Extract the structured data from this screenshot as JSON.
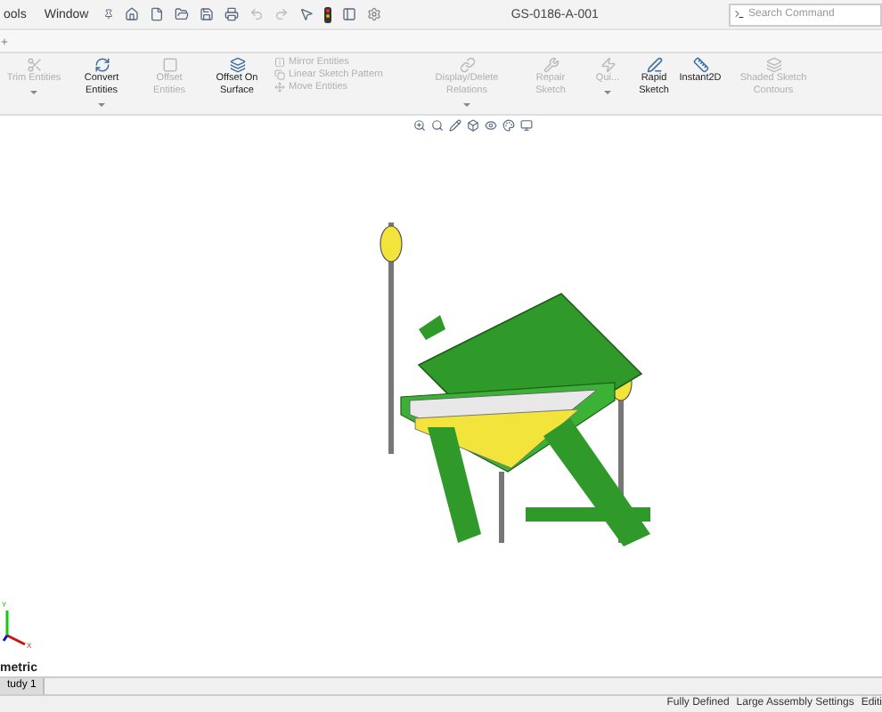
{
  "menu": [
    {
      "label": "ools"
    },
    {
      "label": "Window"
    }
  ],
  "title": "GS-0186-A-001",
  "search": {
    "placeholder": "Search Command"
  },
  "ribbon": [
    {
      "kind": "large",
      "label": "Trim Entities",
      "disabled": true,
      "dropdown": true
    },
    {
      "kind": "large",
      "label": "Convert Entities",
      "disabled": false,
      "dropdown": true
    },
    {
      "kind": "large",
      "label": "Offset Entities",
      "disabled": true,
      "dropdown": false
    },
    {
      "kind": "large",
      "label": "Offset On Surface",
      "disabled": false,
      "dropdown": false
    },
    {
      "kind": "stack",
      "items": [
        {
          "label": "Mirror Entities",
          "disabled": true
        },
        {
          "label": "Linear Sketch Pattern",
          "disabled": true
        },
        {
          "label": "Move Entities",
          "disabled": true
        }
      ]
    },
    {
      "kind": "large",
      "label": "Display/Delete Relations",
      "disabled": true,
      "dropdown": true
    },
    {
      "kind": "large",
      "label": "Repair Sketch",
      "disabled": true,
      "dropdown": false
    },
    {
      "kind": "large",
      "label": "Qui...",
      "disabled": true,
      "dropdown": true
    },
    {
      "kind": "large",
      "label": "Rapid Sketch",
      "disabled": false,
      "dropdown": false
    },
    {
      "kind": "large",
      "label": "Instant2D",
      "disabled": false,
      "dropdown": false
    },
    {
      "kind": "large",
      "label": "Shaded Sketch Contours",
      "disabled": true,
      "dropdown": false
    }
  ],
  "triad": {
    "y_label": "Y",
    "x_label": "X"
  },
  "view_label": "metric",
  "bottom_tabs": [
    {
      "label": "tudy 1",
      "selected": true
    }
  ],
  "status_bar": [
    {
      "text": "Fully Defined"
    },
    {
      "text": "Large Assembly Settings"
    },
    {
      "text": "Editi"
    }
  ]
}
